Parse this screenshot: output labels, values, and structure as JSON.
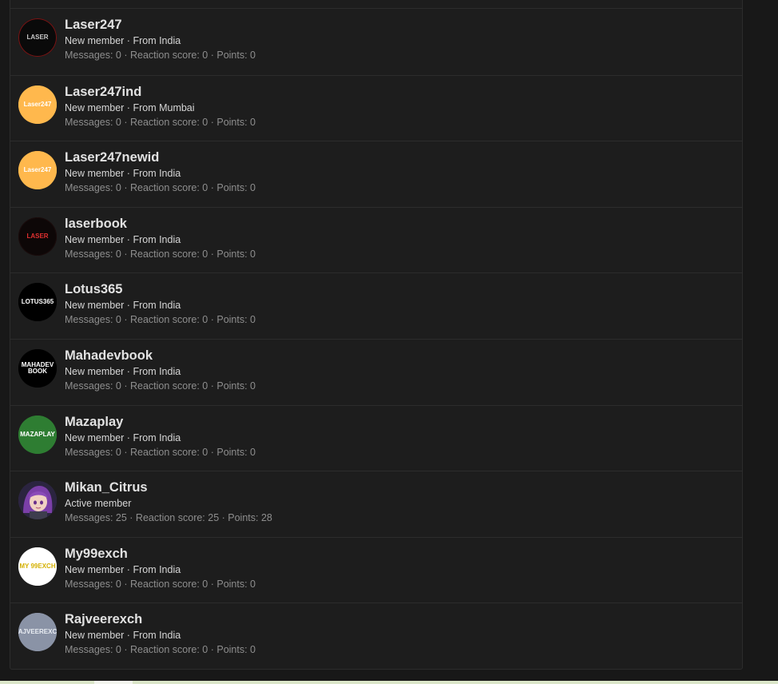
{
  "members": [
    {
      "name": "Laser247",
      "title": "New member",
      "location": "From India",
      "stats": "Messages: 0 · Reaction score: 0 · Points: 0",
      "avatar": {
        "text": "LASER",
        "bg": "#0a0a0a",
        "fg": "#c9c9c9",
        "border": "#7a1414"
      }
    },
    {
      "name": "Laser247ind",
      "title": "New member",
      "location": "From Mumbai",
      "stats": "Messages: 0 · Reaction score: 0 · Points: 0",
      "avatar": {
        "text": "Laser247",
        "bg": "#ffb84d",
        "fg": "#ffffff",
        "border": "#ffb84d"
      }
    },
    {
      "name": "Laser247newid",
      "title": "New member",
      "location": "From India",
      "stats": "Messages: 0 · Reaction score: 0 · Points: 0",
      "avatar": {
        "text": "Laser247",
        "bg": "#ffb84d",
        "fg": "#ffffff",
        "border": "#ffb84d"
      }
    },
    {
      "name": "laserbook",
      "title": "New member",
      "location": "From India",
      "stats": "Messages: 0 · Reaction score: 0 · Points: 0",
      "avatar": {
        "text": "LASER",
        "bg": "#0d0707",
        "fg": "#e23030",
        "border": "#1a0b0b"
      }
    },
    {
      "name": "Lotus365",
      "title": "New member",
      "location": "From India",
      "stats": "Messages: 0 · Reaction score: 0 · Points: 0",
      "avatar": {
        "text": "LOTUS365",
        "bg": "#000000",
        "fg": "#ffffff",
        "border": "#000000"
      }
    },
    {
      "name": "Mahadevbook",
      "title": "New member",
      "location": "From India",
      "stats": "Messages: 0 · Reaction score: 0 · Points: 0",
      "avatar": {
        "text": "MAHADEV BOOK",
        "bg": "#000000",
        "fg": "#ffffff",
        "border": "#000000"
      }
    },
    {
      "name": "Mazaplay",
      "title": "New member",
      "location": "From India",
      "stats": "Messages: 0 · Reaction score: 0 · Points: 0",
      "avatar": {
        "text": "MAZAPLAY",
        "bg": "#2e7d32",
        "fg": "#ffffff",
        "border": "#2e7d32"
      }
    },
    {
      "name": "Mikan_Citrus",
      "title": "Active member",
      "location": "",
      "stats": "Messages: 25 · Reaction score: 25 · Points: 28",
      "avatar": {
        "text": "",
        "bg": "#3a2f55",
        "fg": "#ffffff",
        "border": "#3a2f55"
      }
    },
    {
      "name": "My99exch",
      "title": "New member",
      "location": "From India",
      "stats": "Messages: 0 · Reaction score: 0 · Points: 0",
      "avatar": {
        "text": "MY 99EXCH",
        "bg": "#ffffff",
        "fg": "#d4b000",
        "border": "#ffffff"
      }
    },
    {
      "name": "Rajveerexch",
      "title": "New member",
      "location": "From India",
      "stats": "Messages: 0 · Reaction score: 0 · Points: 0",
      "avatar": {
        "text": "RAJVEEREXCH",
        "bg": "#8a93a6",
        "fg": "#e9edf3",
        "border": "#8a93a6"
      }
    }
  ]
}
